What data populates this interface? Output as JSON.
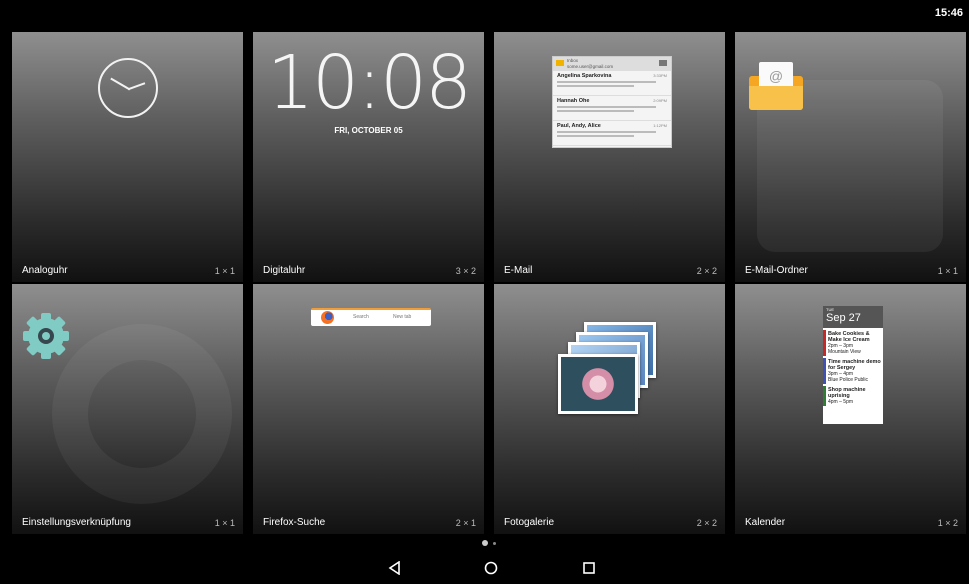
{
  "status_bar": {
    "time": "15:46"
  },
  "widgets": [
    {
      "label": "Analoguhr",
      "size": "1 × 1"
    },
    {
      "label": "Digitaluhr",
      "size": "3 × 2",
      "clock_time": "10:08",
      "clock_date": "FRI, OCTOBER 05"
    },
    {
      "label": "E-Mail",
      "size": "2 × 2",
      "preview": {
        "header": "Inbox",
        "subheader": "some.user@gmail.com",
        "messages": [
          {
            "from": "Angelina Sparkovina",
            "time": "3:33PM"
          },
          {
            "from": "Hannah Ohe",
            "time": "2:09PM"
          },
          {
            "from": "Paul, Andy, Alice",
            "time": "1:12PM"
          }
        ]
      }
    },
    {
      "label": "E-Mail-Ordner",
      "size": "1 × 1"
    },
    {
      "label": "Einstellungsverknüpfung",
      "size": "1 × 1"
    },
    {
      "label": "Firefox-Suche",
      "size": "2 × 1",
      "search_label": "Search",
      "newtab_label": "New tab"
    },
    {
      "label": "Fotogalerie",
      "size": "2 × 2"
    },
    {
      "label": "Kalender",
      "size": "1 × 2",
      "preview": {
        "weekday": "TUE",
        "date": "Sep 27",
        "events": [
          {
            "title": "Bake Cookies & Make Ice Cream",
            "time": "2pm – 3pm",
            "place": "Mountain View",
            "color": "#c62828"
          },
          {
            "title": "Time machine demo for Sergey",
            "time": "3pm – 4pm",
            "place": "Blue Police Public",
            "color": "#3f51b5"
          },
          {
            "title": "Shop machine uprising",
            "time": "4pm – 5pm",
            "place": "",
            "color": "#2e7d32"
          }
        ]
      }
    }
  ],
  "navigation": {
    "back": "back-icon",
    "home": "home-icon",
    "recents": "recents-icon"
  }
}
